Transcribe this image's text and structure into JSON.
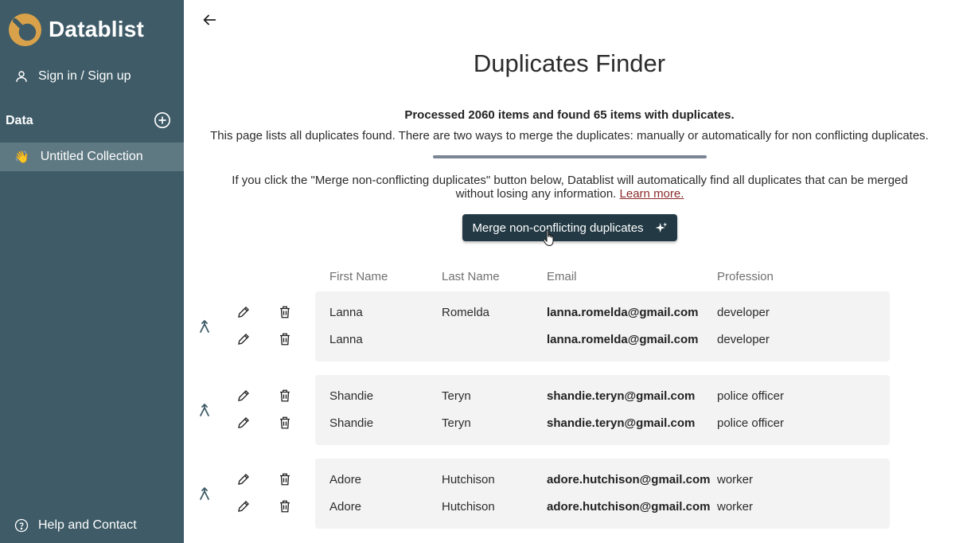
{
  "sidebar": {
    "brand": "Datablist",
    "signin_label": "Sign in / Sign up",
    "data_label": "Data",
    "collection": {
      "emoji": "👋",
      "label": "Untitled Collection"
    },
    "help_label": "Help and Contact"
  },
  "main": {
    "title": "Duplicates Finder",
    "summary": "Processed 2060 items and found 65 items with duplicates.",
    "explanation": "This page lists all duplicates found. There are two ways to merge the duplicates: manually or automatically for non conflicting duplicates.",
    "info_text": "If you click the \"Merge non-conflicting duplicates\" button below, Datablist will automatically find all duplicates that can be merged without losing any information.",
    "learn_more": "Learn more.",
    "merge_button": "Merge non-conflicting duplicates"
  },
  "table": {
    "headers": [
      "First Name",
      "Last Name",
      "Email",
      "Profession"
    ],
    "groups": [
      {
        "rows": [
          {
            "first": "Lanna",
            "last": "Romelda",
            "email": "lanna.romelda@gmail.com",
            "profession": "developer"
          },
          {
            "first": "Lanna",
            "last": "",
            "email": "lanna.romelda@gmail.com",
            "profession": "developer"
          }
        ]
      },
      {
        "rows": [
          {
            "first": "Shandie",
            "last": "Teryn",
            "email": "shandie.teryn@gmail.com",
            "profession": "police officer"
          },
          {
            "first": "Shandie",
            "last": "Teryn",
            "email": "shandie.teryn@gmail.com",
            "profession": "police officer"
          }
        ]
      },
      {
        "rows": [
          {
            "first": "Adore",
            "last": "Hutchison",
            "email": "adore.hutchison@gmail.com",
            "profession": "worker"
          },
          {
            "first": "Adore",
            "last": "Hutchison",
            "email": "adore.hutchison@gmail.com",
            "profession": "worker"
          }
        ]
      }
    ]
  },
  "colors": {
    "sidebar_bg": "#3e5b67",
    "sidebar_active": "#5f7983",
    "button_bg": "#233a45",
    "logo_accent": "#d9a24a",
    "link": "#8b2a2a"
  },
  "icons": [
    "datablist-logo",
    "user-icon",
    "add-circle-icon",
    "help-circle-icon",
    "back-arrow-icon",
    "sparkle-icon",
    "merge-icon",
    "pencil-icon",
    "trash-icon",
    "hand-cursor-icon"
  ]
}
